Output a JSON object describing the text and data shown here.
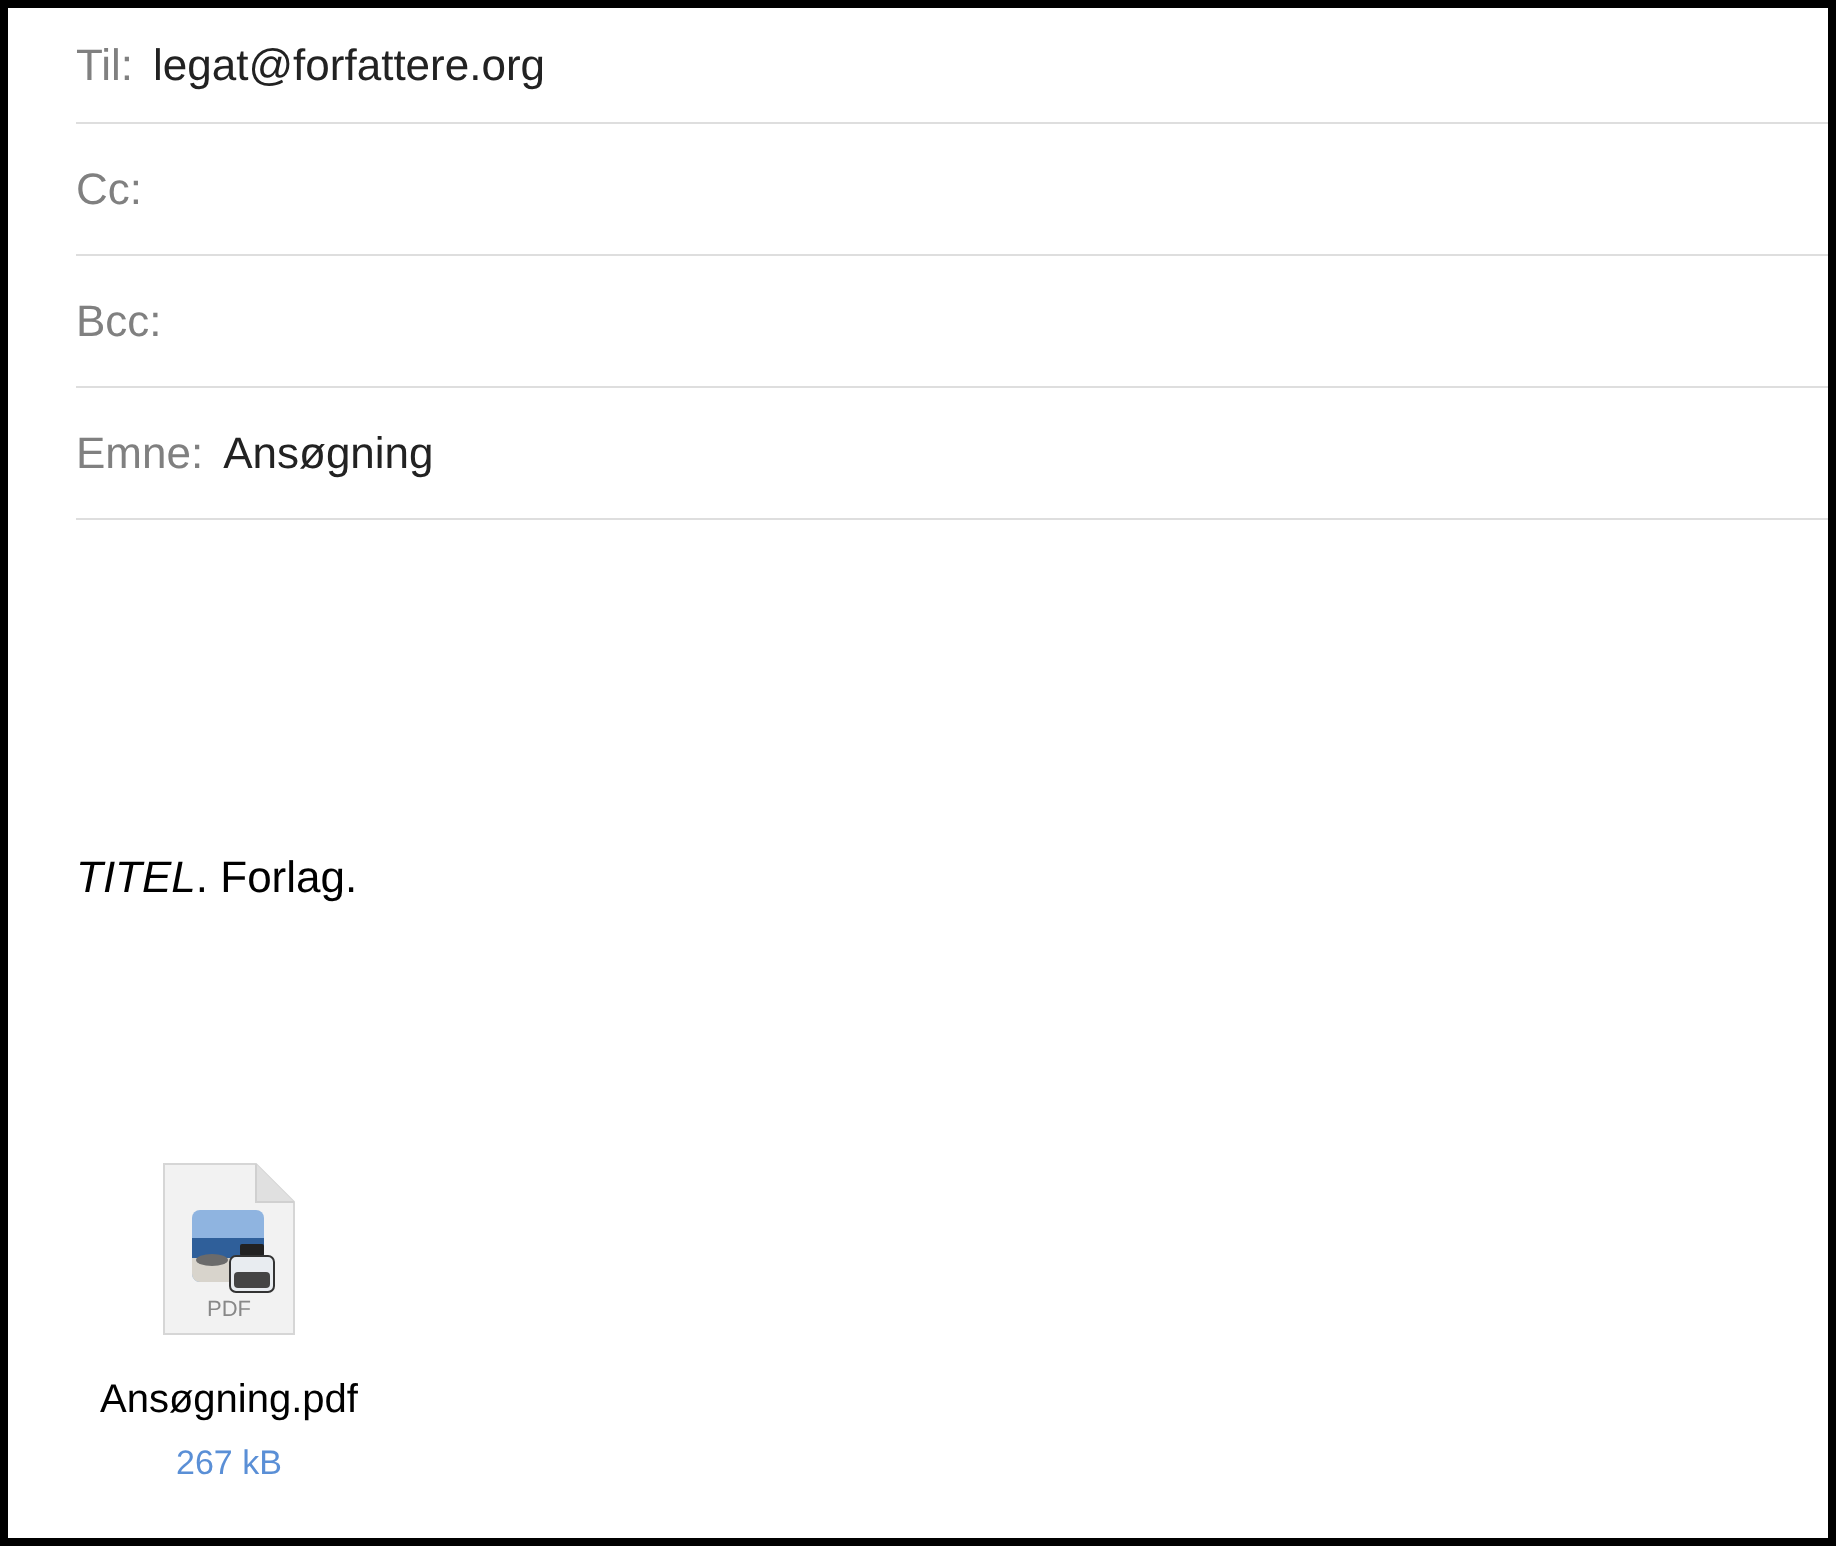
{
  "header_fields": [
    {
      "label": "Til:",
      "value": "legat@forfattere.org"
    },
    {
      "label": "Cc:"
    },
    {
      "label": "Bcc:"
    },
    {
      "label": "Emne:",
      "value": "Ansøgning"
    }
  ],
  "body": {
    "paragraphs": [
      "*TITEL*. Forlag."
    ]
  },
  "attachments": [
    {
      "type_label": "PDF",
      "filename": "Ansøgning.pdf",
      "size": "267 kB"
    }
  ]
}
